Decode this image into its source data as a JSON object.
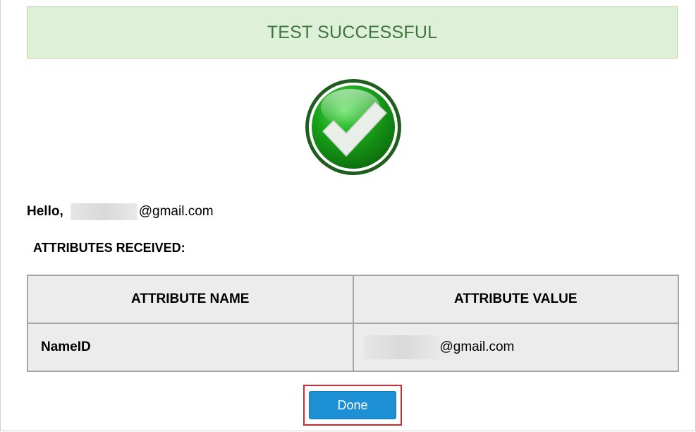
{
  "banner": {
    "title": "TEST SUCCESSFUL"
  },
  "greeting": {
    "prefix": "Hello,",
    "email_suffix": "@gmail.com"
  },
  "attributes": {
    "heading": "ATTRIBUTES RECEIVED:",
    "columns": [
      "ATTRIBUTE NAME",
      "ATTRIBUTE VALUE"
    ],
    "rows": [
      {
        "name": "NameID",
        "value_suffix": "@gmail.com"
      }
    ]
  },
  "actions": {
    "done_label": "Done"
  },
  "colors": {
    "banner_bg": "#dff0d8",
    "banner_text": "#3c763d",
    "check_green": "#1a9a1a",
    "done_button": "#1d8fd4",
    "highlight_border": "#d9252b"
  },
  "icons": {
    "status": "checkmark-success-icon"
  }
}
